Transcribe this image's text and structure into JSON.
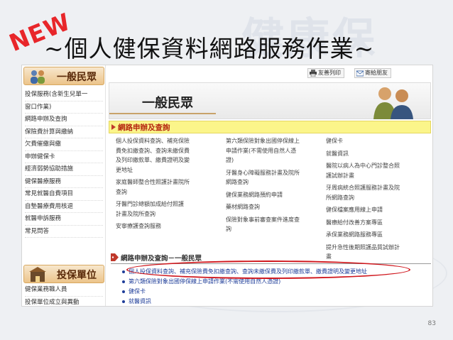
{
  "slide": {
    "badge": "NEW",
    "title": "~個人健保資料網路服務作業~",
    "page_number": "83"
  },
  "sidebar": {
    "section1_title": "一般民眾",
    "section1_items": [
      "投保服務(含新生兒單一",
      "窗口作業)",
      "網路申辦及查詢",
      "保險費計算與繳納",
      "欠費催繳與繳",
      "申辦健保卡",
      "經濟弱勢協助措施",
      "健保醫療服務",
      "常見就醫自費項目",
      "自墊醫療費用核退",
      "就醫申訴服務",
      "常見問答"
    ],
    "section2_title": "投保單位",
    "section2_items": [
      "健保業務職人員",
      "投保單位成立與異動"
    ]
  },
  "toolbar": {
    "print_label": "友善列印",
    "email_label": "寄給朋友"
  },
  "banner": {
    "title": "一般民眾"
  },
  "section": {
    "label": "網路申辦及查詢"
  },
  "services": {
    "col1": [
      "個人投保資料查詢、補充保險",
      "費免扣繳查詢、查詢未繳保費",
      "及列印繳款單、繳費證明及變",
      "更地址",
      "家庭醫師整合性照護計畫院所",
      "查詢",
      "牙醫門診總額加成給付照護",
      "計畫及院所查詢",
      "安寧療護查詢服務"
    ],
    "col2": [
      "第六類保險對象出國停保線上",
      "申請作業(不需使用自然人憑",
      "證)",
      "牙醫身心障礙服務計畫及院所",
      "網路查詢",
      "健保業務網路預約申請",
      "藥材網路查詢",
      "保險對象事前審查案件進度查",
      "詢"
    ],
    "col3": [
      "健保卡",
      "就醫資訊",
      "醫院以病人為中心門診整合照",
      "護試辦計畫",
      "牙周病統合照護服務計畫及院",
      "所網路查詢",
      "健保檔案應用線上申請",
      "醫療給付改善方案專區",
      "承保業務網路服務專區",
      "提升急性後期照護品質試辦計",
      "畫"
    ]
  },
  "query": {
    "header": "網路申辦及查詢－一般民眾",
    "items": [
      "個人投保資料查詢、補充保險費免扣繳查詢、查詢未繳保費及列印繳款單、繳費證明及變更地址",
      "第六類保險對象出國停保線上申請作業(不需使用自然人憑證)",
      "健保卡",
      "就醫資訊"
    ]
  },
  "colors": {
    "accent_red": "#d0181e",
    "link_blue": "#1e3d99",
    "highlight_yellow": "#fbf58a"
  }
}
